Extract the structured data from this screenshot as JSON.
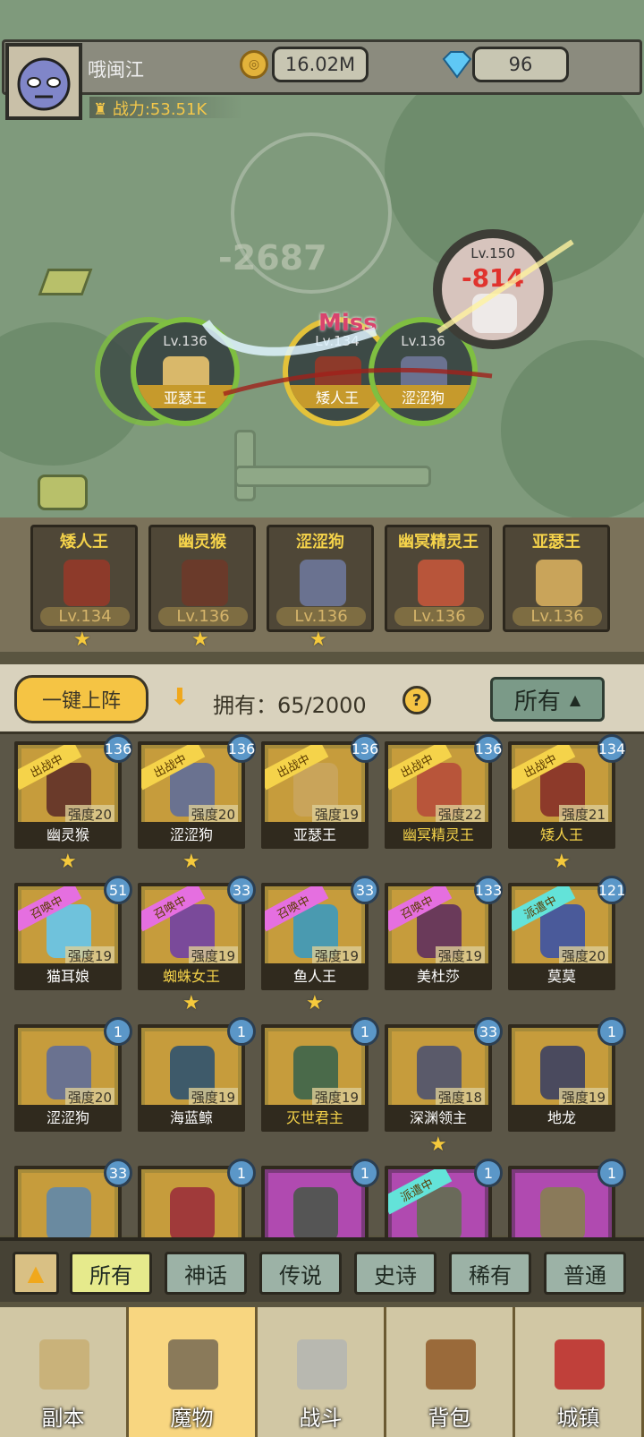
{
  "player": {
    "name": "哦闽江",
    "power": "战力:53.51K",
    "gold": "16.02M",
    "gems": "96"
  },
  "battle": {
    "enemy_level": "Lv.150",
    "enemy_damage": "-814",
    "miss": "Miss",
    "faded_damage": "-2687",
    "heroes": [
      {
        "lv": "Lv.136",
        "name": "亚瑟王"
      },
      {
        "lv": "Lv.134",
        "name": "矮人王"
      },
      {
        "lv": "Lv.136",
        "name": "涩涩狗"
      }
    ]
  },
  "squad": [
    {
      "name": "矮人王",
      "lv": "Lv.134"
    },
    {
      "name": "幽灵猴",
      "lv": "Lv.136"
    },
    {
      "name": "涩涩狗",
      "lv": "Lv.136"
    },
    {
      "name": "幽冥精灵王",
      "lv": "Lv.136"
    },
    {
      "name": "亚瑟王",
      "lv": "Lv.136"
    }
  ],
  "toolbar": {
    "deploy": "一键上阵",
    "owned": "拥有：65/2000",
    "help": "?",
    "filter": "所有"
  },
  "monsters": [
    {
      "name": "幽灵猴",
      "strength": "强度20",
      "level": "136",
      "tag": "出战中"
    },
    {
      "name": "涩涩狗",
      "strength": "强度20",
      "level": "136",
      "tag": "出战中"
    },
    {
      "name": "亚瑟王",
      "strength": "强度19",
      "level": "136",
      "tag": "出战中"
    },
    {
      "name": "幽冥精灵王",
      "strength": "强度22",
      "level": "136",
      "tag": "出战中"
    },
    {
      "name": "矮人王",
      "strength": "强度21",
      "level": "134",
      "tag": "出战中"
    },
    {
      "name": "猫耳娘",
      "strength": "强度19",
      "level": "51",
      "tag": "召唤中"
    },
    {
      "name": "蜘蛛女王",
      "strength": "强度19",
      "level": "33",
      "tag": "召唤中"
    },
    {
      "name": "鱼人王",
      "strength": "强度19",
      "level": "33",
      "tag": "召唤中"
    },
    {
      "name": "美杜莎",
      "strength": "强度19",
      "level": "133",
      "tag": "召唤中"
    },
    {
      "name": "莫莫",
      "strength": "强度20",
      "level": "121",
      "tag": "派遣中"
    },
    {
      "name": "涩涩狗",
      "strength": "强度20",
      "level": "1",
      "tag": ""
    },
    {
      "name": "海蓝鲸",
      "strength": "强度19",
      "level": "1",
      "tag": ""
    },
    {
      "name": "灭世君主",
      "strength": "强度19",
      "level": "1",
      "tag": ""
    },
    {
      "name": "深渊领主",
      "strength": "强度18",
      "level": "33",
      "tag": ""
    },
    {
      "name": "地龙",
      "strength": "强度19",
      "level": "1",
      "tag": ""
    },
    {
      "level": "33",
      "tag": ""
    },
    {
      "level": "1",
      "tag": ""
    },
    {
      "level": "1",
      "tag": ""
    },
    {
      "level": "1",
      "tag": "派遣中"
    },
    {
      "level": "1",
      "tag": ""
    }
  ],
  "rarity": [
    "所有",
    "神话",
    "传说",
    "史诗",
    "稀有",
    "普通"
  ],
  "nav": [
    "副本",
    "魔物",
    "战斗",
    "背包",
    "城镇"
  ],
  "colors": {
    "tag_active": "#f5d34a",
    "tag_summon": "#e56fe0",
    "tag_dispatch": "#63e3d9",
    "tab_selected": "#f8d680"
  }
}
